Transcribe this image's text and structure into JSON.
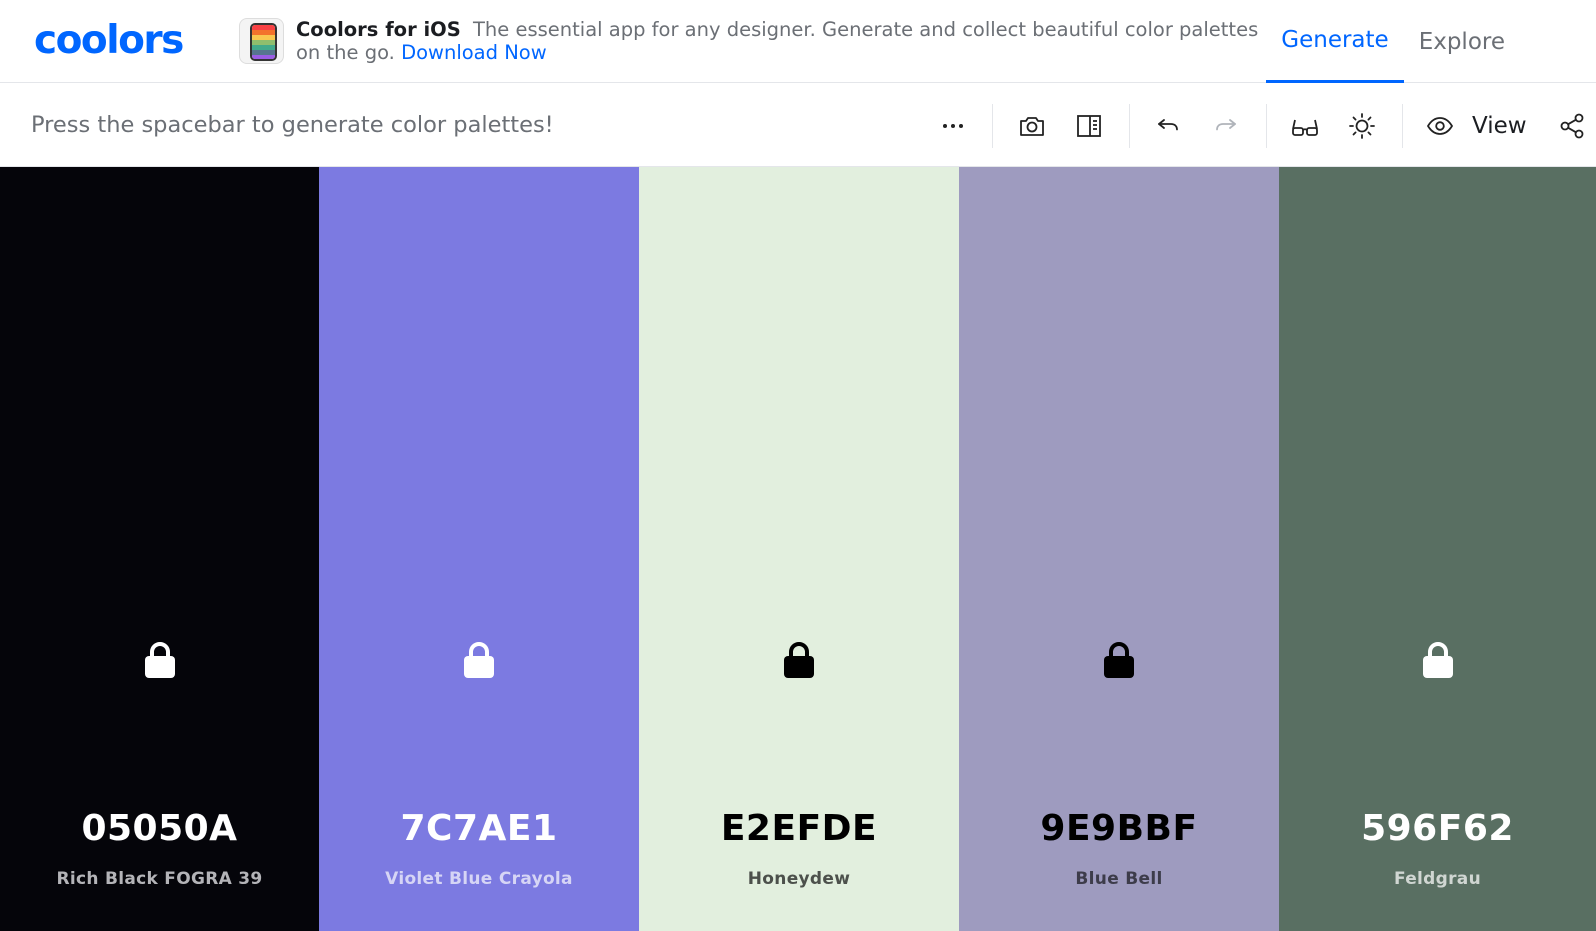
{
  "brand": {
    "logo_text": "coolors",
    "accent": "#0066ff"
  },
  "promo": {
    "icon": "coolors-ios-app-icon",
    "title": "Coolors for iOS",
    "text": "The essential app for any designer. Generate and collect beautiful color palettes on the go.",
    "link": "Download Now"
  },
  "nav": {
    "tabs": [
      {
        "label": "Generate",
        "active": true
      },
      {
        "label": "Explore",
        "active": false
      }
    ]
  },
  "toolbar": {
    "hint": "Press the spacebar to generate color palettes!",
    "icons": [
      "more-icon",
      "camera-icon",
      "split-view-icon",
      "undo-icon",
      "redo-icon",
      "glasses-icon",
      "sun-icon",
      "eye-icon",
      "share-icon"
    ],
    "view_label": "View"
  },
  "palette": [
    {
      "hex": "05050A",
      "name": "Rich Black FOGRA 39",
      "bg": "#05050A",
      "fg": "#ffffff",
      "sub": "#b4b4b8"
    },
    {
      "hex": "7C7AE1",
      "name": "Violet Blue Crayola",
      "bg": "#7C7AE1",
      "fg": "#ffffff",
      "sub": "#d6d5f5"
    },
    {
      "hex": "E2EFDE",
      "name": "Honeydew",
      "bg": "#E2EFDE",
      "fg": "#000000",
      "sub": "#4c504b"
    },
    {
      "hex": "9E9BBF",
      "name": "Blue Bell",
      "bg": "#9E9BBF",
      "fg": "#000000",
      "sub": "#3d3c4a"
    },
    {
      "hex": "596F62",
      "name": "Feldgrau",
      "bg": "#596F62",
      "fg": "#ffffff",
      "sub": "#d0d6d2"
    }
  ]
}
